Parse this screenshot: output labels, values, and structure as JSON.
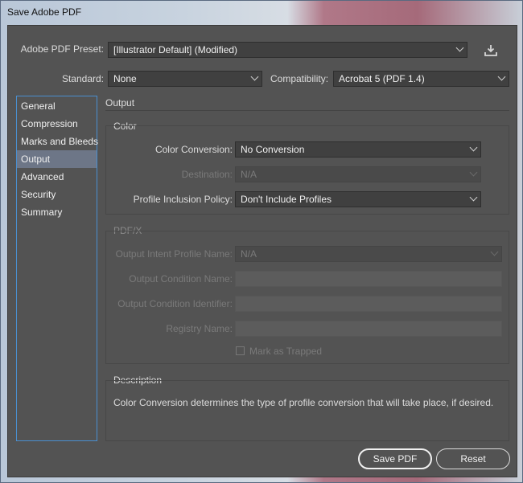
{
  "window": {
    "title": "Save Adobe PDF"
  },
  "top": {
    "preset_label": "Adobe PDF Preset:",
    "preset_value": "[Illustrator Default] (Modified)",
    "standard_label": "Standard:",
    "standard_value": "None",
    "compat_label": "Compatibility:",
    "compat_value": "Acrobat 5 (PDF 1.4)",
    "save_preset_icon": "save-preset-icon"
  },
  "nav": {
    "items": [
      {
        "label": "General"
      },
      {
        "label": "Compression"
      },
      {
        "label": "Marks and Bleeds"
      },
      {
        "label": "Output"
      },
      {
        "label": "Advanced"
      },
      {
        "label": "Security"
      },
      {
        "label": "Summary"
      }
    ],
    "selected": "Output"
  },
  "panel": {
    "title": "Output",
    "color": {
      "title": "Color",
      "conversion_label": "Color Conversion:",
      "conversion_value": "No Conversion",
      "destination_label": "Destination:",
      "destination_value": "N/A",
      "profile_label": "Profile Inclusion Policy:",
      "profile_value": "Don't Include Profiles"
    },
    "pdfx": {
      "title": "PDF/X",
      "intent_label": "Output Intent Profile Name:",
      "intent_value": "N/A",
      "condition_name_label": "Output Condition Name:",
      "condition_id_label": "Output Condition Identifier:",
      "registry_label": "Registry Name:",
      "trapped_label": "Mark as Trapped"
    },
    "description": {
      "title": "Description",
      "text": "Color Conversion determines the type of profile conversion that will take place, if desired."
    }
  },
  "buttons": {
    "save": "Save PDF",
    "reset": "Reset"
  }
}
